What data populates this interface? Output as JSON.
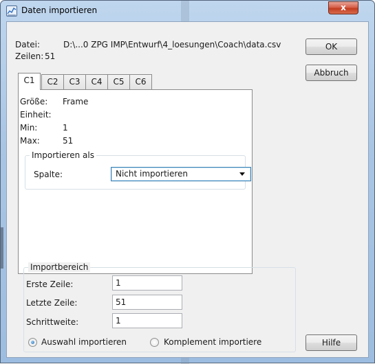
{
  "window": {
    "title": "Daten importieren",
    "close_glyph": "x"
  },
  "info": {
    "file_label": "Datei:",
    "file_value": "D:\\...0 ZPG IMP\\Entwurf\\4_loesungen\\Coach\\data.csv",
    "rows_label": "Zeilen:",
    "rows_value": "51"
  },
  "buttons": {
    "ok": "OK",
    "cancel": "Abbruch",
    "help": "Hilfe"
  },
  "tabs": [
    "C1",
    "C2",
    "C3",
    "C4",
    "C5",
    "C6"
  ],
  "column": {
    "size_label": "Größe:",
    "size_value": "Frame",
    "unit_label": "Einheit:",
    "unit_value": "",
    "min_label": "Min:",
    "min_value": "1",
    "max_label": "Max:",
    "max_value": "51"
  },
  "import_as": {
    "legend": "Importieren als",
    "column_label": "Spalte:",
    "selected": "Nicht importieren"
  },
  "range": {
    "legend": "Importbereich",
    "first_label": "Erste Zeile:",
    "first_value": "1",
    "last_label": "Letzte Zeile:",
    "last_value": "51",
    "step_label": "Schrittweite:",
    "step_value": "1"
  },
  "options": {
    "import_selection": "Auswahl importieren",
    "import_complement": "Komplement importiere",
    "selected": "import_selection"
  }
}
